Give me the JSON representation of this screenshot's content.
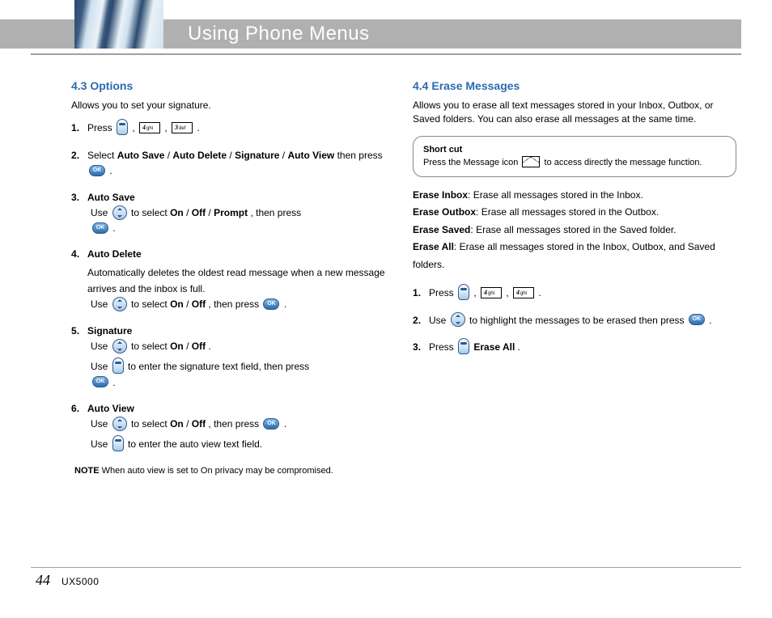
{
  "header": {
    "title": "Using Phone Menus"
  },
  "left": {
    "title": "4.3 Options",
    "subtitle": "Allows you to set your signature.",
    "steps": [
      {
        "pre": "Press ",
        "icons": [
          "soft-left"
        ],
        "mid1": " , ",
        "icons2": [
          "key-4ghi"
        ],
        "mid2": " , ",
        "icons3": [
          "key-3def"
        ],
        "post": " ."
      },
      {
        "pre": "Select ",
        "bold": "Auto Save",
        "mid1": " / ",
        "bold2": "Auto Delete",
        "mid2": " / ",
        "bold3": "Signature",
        "post": " / ",
        "bold4": "Auto View",
        "end": " then press ",
        "icons": [
          "ok"
        ],
        "after": "."
      },
      {
        "bold": "Auto Save",
        "pre": " ",
        "bullets": [
          {
            "t1": "Use ",
            "icon": "nav",
            "t2": " to select ",
            "b": "On",
            "t3": " / ",
            "b2": "Off",
            "t4": " / ",
            "b3": "Prompt",
            "t5": ", then press ",
            "icon2": "ok",
            "t6": "."
          }
        ]
      },
      {
        "bold": "Auto Delete",
        "pre": "",
        "post_text": "Automatically deletes the oldest read message when a new message arrives and the inbox is full.",
        "bullets": [
          {
            "t1": "Use ",
            "icon": "nav",
            "t2": " to select ",
            "b": "On",
            "t3": " / ",
            "b2": "Off",
            "t4": ", then press ",
            "icon2": "ok",
            "t6": "."
          }
        ]
      },
      {
        "bold": "Signature",
        "bullets": [
          {
            "t1": "Use ",
            "icon": "nav",
            "t2": " to select ",
            "b": "On",
            "t3": " / ",
            "b2": "Off",
            "t4": "."
          },
          {
            "t1": "Use ",
            "icon": "soft-left",
            "t2": " to enter the signature text field, then press ",
            "icon2": "ok",
            "t6": "."
          }
        ]
      },
      {
        "bold": "Auto View",
        "bullets": [
          {
            "t1": "Use ",
            "icon": "nav",
            "t2": " to select ",
            "b": "On",
            "t3": " / ",
            "b2": "Off",
            "t4": ", then press ",
            "icon2": "ok",
            "t6": "."
          },
          {
            "t1": "Use ",
            "icon": "soft-left",
            "t2": " to enter the auto view text field."
          }
        ]
      },
      {
        "type": "note",
        "label": "NOTE",
        "text": "When auto view is set to On privacy may be compromised."
      }
    ]
  },
  "right": {
    "title": "4.4 Erase Messages",
    "subtitle_pre": "Allows you to erase all text messages stored in your Inbox, Outbox, or Saved folders. You can also erase all messages at the same time.",
    "shortcut_pre": "Press the Message icon ",
    "shortcut_post": " to access directly the message function.",
    "steps2": [
      {
        "label": "Erase Inbox",
        "desc": "Erase all messages stored in the Inbox."
      },
      {
        "label": "Erase Outbox",
        "desc": "Erase all messages stored in the Outbox."
      },
      {
        "label": "Erase Saved",
        "desc": "Erase all messages stored in the Saved folder."
      },
      {
        "label": "Erase All",
        "desc": "Erase all messages stored in the Inbox, Outbox, and Saved folders."
      }
    ],
    "substeps": {
      "s1_pre": "Press ",
      "s1_post": " .",
      "s2_pre": "Use ",
      "s2_mid": " to highlight the messages to be erased then press ",
      "s2_post": " .",
      "s3_pre": "Press ",
      "s3_mid": "  ",
      "s3_bold": "Erase All",
      "s3_post": "."
    }
  },
  "footer": {
    "page": "44",
    "model": "UX5000"
  }
}
